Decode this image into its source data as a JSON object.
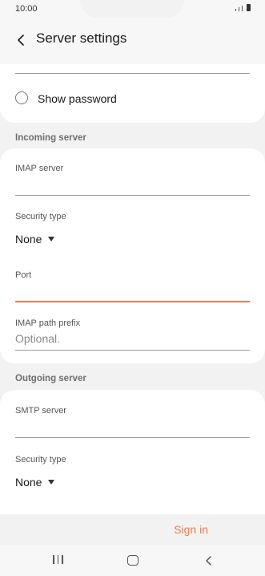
{
  "status_bar": {
    "time": "10:00"
  },
  "header": {
    "title": "Server settings"
  },
  "password": {
    "show_password_label": "Show password"
  },
  "incoming": {
    "section_title": "Incoming server",
    "imap_server_label": "IMAP server",
    "security_type_label": "Security type",
    "security_type_value": "None",
    "port_label": "Port",
    "imap_path_prefix_label": "IMAP path prefix",
    "imap_path_prefix_placeholder": "Optional."
  },
  "outgoing": {
    "section_title": "Outgoing server",
    "smtp_server_label": "SMTP server",
    "security_type_label": "Security type",
    "security_type_value": "None"
  },
  "actions": {
    "sign_in_label": "Sign in"
  },
  "colors": {
    "accent": "#f07a4e",
    "card": "#ffffff",
    "background": "#f2f2f2"
  }
}
